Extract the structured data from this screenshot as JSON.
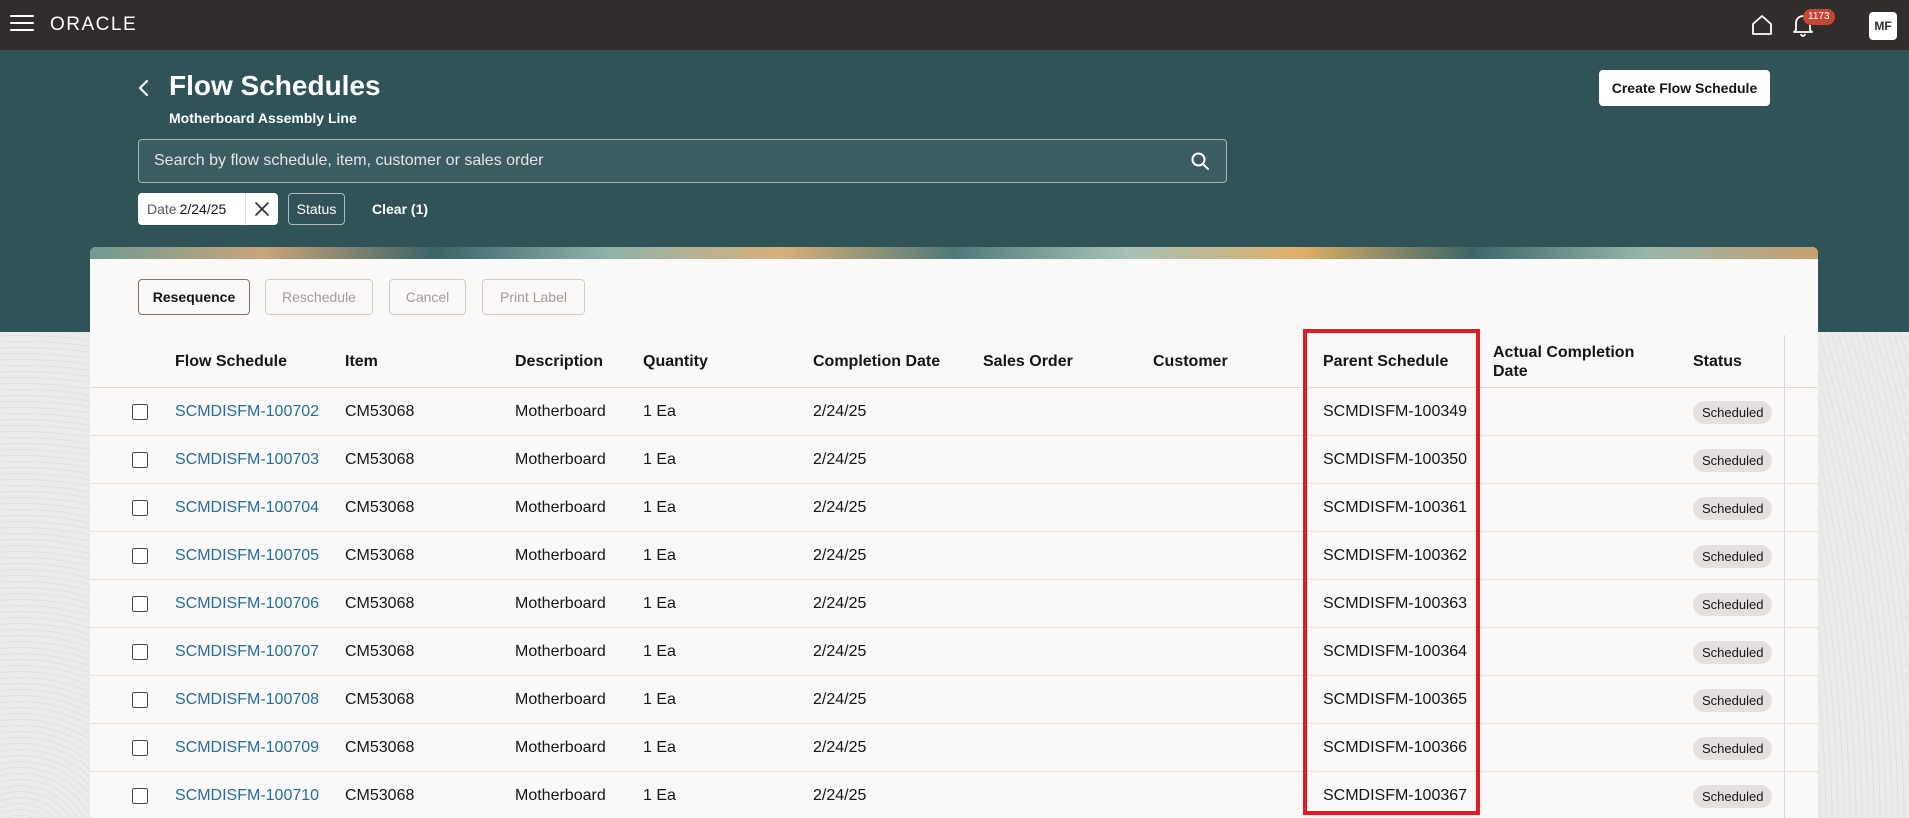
{
  "topbar": {
    "logo": "ORACLE",
    "notification_count": "1173",
    "avatar_initials": "MF"
  },
  "header": {
    "title": "Flow Schedules",
    "subtitle": "Motherboard Assembly Line",
    "create_button": "Create Flow Schedule",
    "search_placeholder": "Search by flow schedule, item, customer or sales order",
    "filters": {
      "date_label": "Date",
      "date_value": "2/24/25",
      "status_label": "Status",
      "clear_label": "Clear (1)"
    }
  },
  "toolbar": {
    "resequence": "Resequence",
    "reschedule": "Reschedule",
    "cancel": "Cancel",
    "print_label": "Print Label"
  },
  "table": {
    "columns": {
      "flow_schedule": "Flow Schedule",
      "item": "Item",
      "description": "Description",
      "quantity": "Quantity",
      "completion_date": "Completion Date",
      "sales_order": "Sales Order",
      "customer": "Customer",
      "parent_schedule": "Parent Schedule",
      "actual_completion_date": "Actual Completion Date",
      "status": "Status"
    },
    "rows": [
      {
        "flow_schedule": "SCMDISFM-100702",
        "item": "CM53068",
        "description": "Motherboard",
        "quantity": "1 Ea",
        "completion_date": "2/24/25",
        "parent_schedule": "SCMDISFM-100349",
        "status": "Scheduled"
      },
      {
        "flow_schedule": "SCMDISFM-100703",
        "item": "CM53068",
        "description": "Motherboard",
        "quantity": "1 Ea",
        "completion_date": "2/24/25",
        "parent_schedule": "SCMDISFM-100350",
        "status": "Scheduled"
      },
      {
        "flow_schedule": "SCMDISFM-100704",
        "item": "CM53068",
        "description": "Motherboard",
        "quantity": "1 Ea",
        "completion_date": "2/24/25",
        "parent_schedule": "SCMDISFM-100361",
        "status": "Scheduled"
      },
      {
        "flow_schedule": "SCMDISFM-100705",
        "item": "CM53068",
        "description": "Motherboard",
        "quantity": "1 Ea",
        "completion_date": "2/24/25",
        "parent_schedule": "SCMDISFM-100362",
        "status": "Scheduled"
      },
      {
        "flow_schedule": "SCMDISFM-100706",
        "item": "CM53068",
        "description": "Motherboard",
        "quantity": "1 Ea",
        "completion_date": "2/24/25",
        "parent_schedule": "SCMDISFM-100363",
        "status": "Scheduled"
      },
      {
        "flow_schedule": "SCMDISFM-100707",
        "item": "CM53068",
        "description": "Motherboard",
        "quantity": "1 Ea",
        "completion_date": "2/24/25",
        "parent_schedule": "SCMDISFM-100364",
        "status": "Scheduled"
      },
      {
        "flow_schedule": "SCMDISFM-100708",
        "item": "CM53068",
        "description": "Motherboard",
        "quantity": "1 Ea",
        "completion_date": "2/24/25",
        "parent_schedule": "SCMDISFM-100365",
        "status": "Scheduled"
      },
      {
        "flow_schedule": "SCMDISFM-100709",
        "item": "CM53068",
        "description": "Motherboard",
        "quantity": "1 Ea",
        "completion_date": "2/24/25",
        "parent_schedule": "SCMDISFM-100366",
        "status": "Scheduled"
      },
      {
        "flow_schedule": "SCMDISFM-100710",
        "item": "CM53068",
        "description": "Motherboard",
        "quantity": "1 Ea",
        "completion_date": "2/24/25",
        "parent_schedule": "SCMDISFM-100367",
        "status": "Scheduled"
      }
    ]
  },
  "colors": {
    "topbar": "#312d2a",
    "header": "#2f5356",
    "link": "#1f6ea3",
    "highlight": "#e01b24",
    "badge": "#c74634"
  },
  "icons": [
    "menu-icon",
    "home-icon",
    "bell-icon",
    "back-icon",
    "search-icon",
    "close-icon"
  ]
}
